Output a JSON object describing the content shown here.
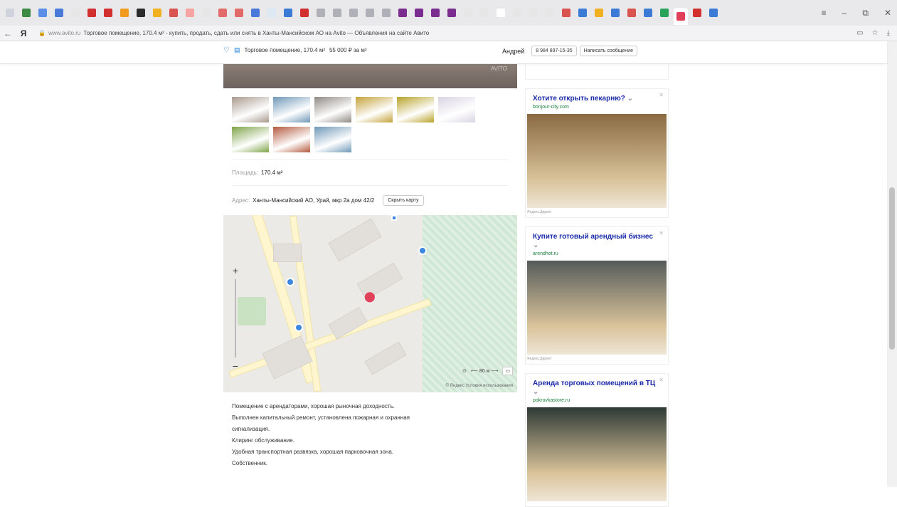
{
  "browser": {
    "address_domain": "www.avito.ru",
    "address_title": "Торговое помещение, 170.4 м² - купить, продать, сдать или снять в Ханты-Мансийском АО на Avito — Объявления на сайте Авито",
    "tab_colors": [
      "#cfd4dc",
      "#3d8a45",
      "#5b8ee6",
      "#4a7ad9",
      "#e6e6e6",
      "#d22f2f",
      "#d22f2f",
      "#f09a20",
      "#2b2b2b",
      "#f0b020",
      "#d9534f",
      "#f5a3a3",
      "#e6e6e6",
      "#e36a6a",
      "#e36a6a",
      "#4a7ad9",
      "#dce9f5",
      "#3b7bd6",
      "#d22f2f",
      "#b0b0b8",
      "#b0b0b8",
      "#b0b0b8",
      "#b0b0b8",
      "#b0b0b8",
      "#7a2d8f",
      "#7a2d8f",
      "#7a2d8f",
      "#7a2d8f",
      "#e6e6e6",
      "#e6e6e6",
      "#ffffff",
      "#e6e6e6",
      "#e6e6e6",
      "#e6e6e6",
      "#d9534f",
      "#3b7bd6",
      "#f0b020",
      "#3b7bd6",
      "#d9534f",
      "#3b7bd6",
      "#29a35a",
      "#e0405a",
      "#d22f2f",
      "#3b7bd6"
    ]
  },
  "sticky": {
    "title": "Торговое помещение, 170.4 м²",
    "price": "55 000 ₽ за м²",
    "seller": "Андрей",
    "phone": "8 984 897-15-35",
    "message_button": "Написать сообщение"
  },
  "listing": {
    "watermark": "AVITO",
    "thumb_colors": [
      "#a99a8e",
      "#6f98b8",
      "#8f8984",
      "#c4a23a",
      "#b8a22a",
      "#d9d4e2",
      "#7fa44a",
      "#b45a3e",
      "#6f98b8"
    ],
    "area_label": "Площадь:",
    "area_value": "170.4 м²",
    "address_label": "Адрес:",
    "address_value": "Ханты-Мансийский АО, Урай, мкр 2а дом 42/2",
    "hide_map_button": "Скрыть карту",
    "map_copyright": "© Яндекс Условия использования",
    "description": [
      "Помещение с арендаторами, хорошая рыночная доходность.",
      "Выполнен капитальный ремонт, установлена пожарная и охранная",
      "сигнализация.",
      "Клиринг обслуживание.",
      "Удобная транспортная развязка, хорошая парковочная зона.",
      "Собственник."
    ]
  },
  "ads": [
    {
      "title": "Хотите открыть пекарню?",
      "domain": "bonjour-city.com",
      "img_color": "#8a6a42",
      "source": "Яндекс.Директ"
    },
    {
      "title": "Купите готовый арендный бизнес",
      "domain": "arendhot.ru",
      "img_color": "#555b5a",
      "source": "Яндекс.Директ"
    },
    {
      "title": "Аренда торговых помещений в ТЦ",
      "domain": "pokrovkastore.ru",
      "img_color": "#2f3a36",
      "source": ""
    }
  ]
}
